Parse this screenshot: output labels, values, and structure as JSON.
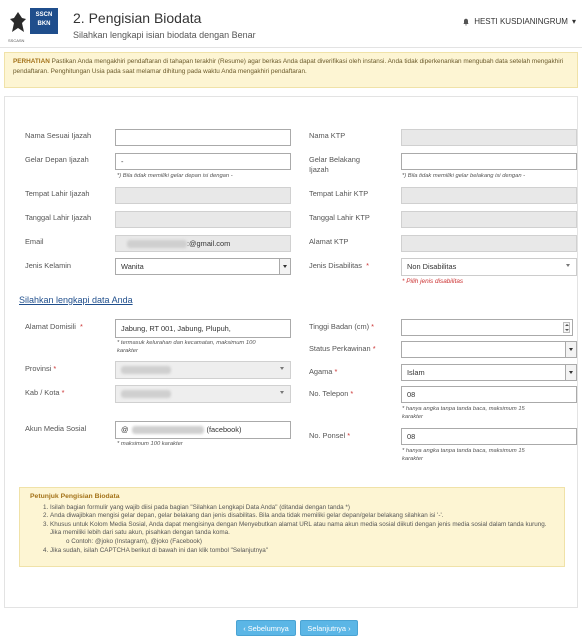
{
  "header": {
    "logo_box_text": "SSCN",
    "logo_box_sub": "BKN",
    "logo_caption": "SSCASN",
    "title": "2. Pengisian Biodata",
    "subtitle": "Silahkan lengkapi isian biodata dengan Benar",
    "user_name": "HESTI KUSDIANINGRUM",
    "user_caret": "▾"
  },
  "notice": {
    "label": "PERHATIAN",
    "text": " Pastikan Anda mengakhiri pendaftaran di tahapan terakhir (Resume) agar berkas Anda dapat diverifikasi oleh instansi. Anda tidak diperkenankan mengubah data setelah mengakhiri pendaftaran. Penghitungan Usia pada saat melamar dihitung pada waktu Anda mengakhiri pendaftaran."
  },
  "form": {
    "nama_ijazah_label": "Nama Sesuai Ijazah",
    "gelar_depan_label": "Gelar Depan Ijazah",
    "gelar_depan_value": "-",
    "gelar_depan_hint": "*) Bila tidak memiliki gelar depan isi dengan -",
    "tempat_lahir_ijazah_label": "Tempat Lahir Ijazah",
    "tanggal_lahir_ijazah_label": "Tanggal Lahir Ijazah",
    "email_label": "Email",
    "email_value": ":@gmail.com",
    "jenis_kelamin_label": "Jenis Kelamin",
    "jenis_kelamin_value": "Wanita",
    "nama_ktp_label": "Nama KTP",
    "gelar_belakang_label_1": "Gelar Belakang",
    "gelar_belakang_label_2": "Ijazah",
    "gelar_belakang_hint": "*) Bila tidak memiliki gelar belakang isi dengan -",
    "tempat_lahir_ktp_label": "Tempat Lahir KTP",
    "tanggal_lahir_ktp_label": "Tanggal Lahir KTP",
    "alamat_ktp_label": "Alamat KTP",
    "disabilitas_label": "Jenis Disabilitas",
    "disabilitas_value": "Non Disabilitas",
    "disabilitas_error": "* Pilih jenis disabilitas",
    "section_title": "Silahkan lengkapi data Anda",
    "alamat_domisili_label": "Alamat Domisili",
    "alamat_domisili_value": "Jabung, RT 001, Jabung, Plupuh,",
    "alamat_domisili_hint_1": "* termasuk kelurahan dan kecamatan, maksimum 100",
    "alamat_domisili_hint_2": "karakter",
    "provinsi_label": "Provinsi",
    "kab_kota_label": "Kab / Kota",
    "akun_medsos_label": "Akun Media Sosial",
    "akun_medsos_prefix": "@",
    "akun_medsos_suffix": "(facebook)",
    "akun_medsos_hint": "* maksimum 100 karakter",
    "tinggi_badan_label": "Tinggi Badan (cm)",
    "status_perkawinan_label": "Status Perkawinan",
    "agama_label": "Agama",
    "agama_value": "Islam",
    "no_telepon_label": "No. Telepon",
    "no_telepon_value": "08",
    "no_telepon_hint_1": "* hanya angka tanpa tanda baca, maksimum 15",
    "no_telepon_hint_2": "karakter",
    "no_ponsel_label": "No. Ponsel",
    "no_ponsel_value": "08",
    "no_ponsel_hint_1": "* hanya angka tanpa tanda baca, maksimum 15",
    "no_ponsel_hint_2": "karakter",
    "required_mark": "*"
  },
  "guide": {
    "title": "Petunjuk Pengisian Biodata",
    "items": [
      "Isilah bagian formulir yang wajib diisi pada bagian \"Silahkan Lengkapi Data Anda\" (ditandai dengan tanda *)",
      "Anda diwajibkan mengisi gelar depan, gelar belakang dan jenis disabilitas. Bila anda tidak memiliki gelar depan/gelar belakang silahkan isi '-'.",
      "Khusus untuk Kolom Media Sosial, Anda dapat mengisinya dengan Menyebutkan alamat URL atau nama akun media sosial diikuti dengan jenis media sosial dalam tanda kurung. Jika memiliki lebih dari satu akun, pisahkan dengan tanda koma.",
      "Jika sudah, isilah CAPTCHA berikut di bawah ini dan klik tombol \"Selanjutnya\""
    ],
    "sub_item": "o  Contoh: @joko (Instagram), @joko (Facebook)"
  },
  "nav": {
    "prev_label": "‹ Sebelumnya",
    "next_label": "Selanjutnya ›"
  },
  "colors": {
    "brand": "#1f4e8c",
    "button": "#5bb6e6",
    "notice_bg": "#fdf5d3",
    "error": "#cc3333"
  }
}
